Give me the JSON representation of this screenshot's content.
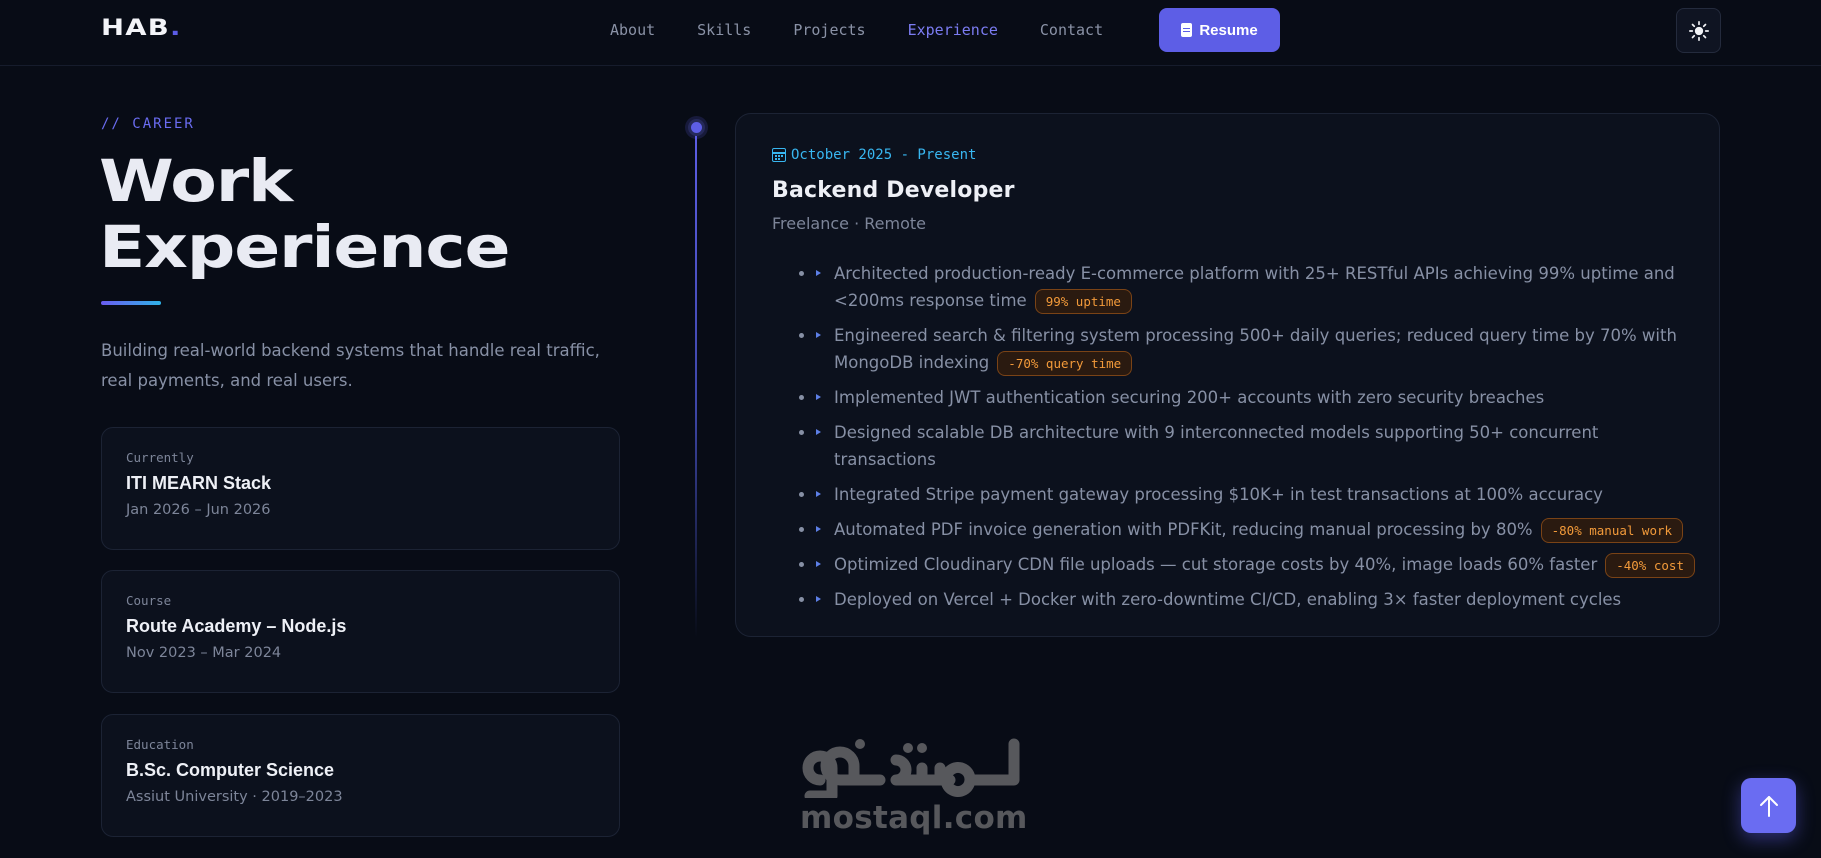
{
  "navbar": {
    "logo_text": "HAB",
    "logo_dot": ".",
    "links": [
      {
        "label": "About",
        "active": false
      },
      {
        "label": "Skills",
        "active": false
      },
      {
        "label": "Projects",
        "active": false
      },
      {
        "label": "Experience",
        "active": true
      },
      {
        "label": "Contact",
        "active": false
      }
    ],
    "resume_label": "Resume",
    "resume_icon": "document-icon",
    "theme_icon": "sun-icon"
  },
  "intro": {
    "eyebrow": "// CAREER",
    "title_line1": "Work",
    "title_line2": "Experience",
    "description": "Building real-world backend systems that handle real traffic, real payments, and real users."
  },
  "side_cards": [
    {
      "kind": "Currently",
      "name": "ITI MEARN Stack",
      "dates": "Jan 2026 – Jun 2026"
    },
    {
      "kind": "Course",
      "name": "Route Academy – Node.js",
      "dates": "Nov 2023 – Mar 2024"
    },
    {
      "kind": "Education",
      "name": "B.Sc. Computer Science",
      "dates": "Assiut University · 2019–2023"
    }
  ],
  "experience": {
    "date": "October 2025 - Present",
    "date_icon": "calendar-icon",
    "role": "Backend Developer",
    "org": "Freelance · Remote",
    "bullets": [
      {
        "text": "Architected production-ready E-commerce platform with 25+ RESTful APIs achieving 99% uptime and <200ms response time",
        "badge": "99% uptime"
      },
      {
        "text": "Engineered search & filtering system processing 500+ daily queries; reduced query time by 70% with MongoDB indexing",
        "badge": "-70% query time"
      },
      {
        "text": "Implemented JWT authentication securing 200+ accounts with zero security breaches",
        "badge": ""
      },
      {
        "text": "Designed scalable DB architecture with 9 interconnected models supporting 50+ concurrent transactions",
        "badge": ""
      },
      {
        "text": "Integrated Stripe payment gateway processing $10K+ in test transactions at 100% accuracy",
        "badge": ""
      },
      {
        "text": "Automated PDF invoice generation with PDFKit, reducing manual processing by 80%",
        "badge": "-80% manual work"
      },
      {
        "text": "Optimized Cloudinary CDN file uploads — cut storage costs by 40%, image loads 60% faster",
        "badge": "-40% cost"
      },
      {
        "text": "Deployed on Vercel + Docker with zero-downtime CI/CD, enabling 3× faster deployment cycles",
        "badge": ""
      }
    ]
  },
  "watermark": {
    "arabic": "مستقل",
    "latin": "mostaql.com"
  },
  "scroll_top_icon": "arrow-up-icon",
  "colors": {
    "background": "#080c16",
    "accent": "#5d5ee6",
    "date_blue": "#38b6f0",
    "badge_orange": "#f29a3a"
  }
}
